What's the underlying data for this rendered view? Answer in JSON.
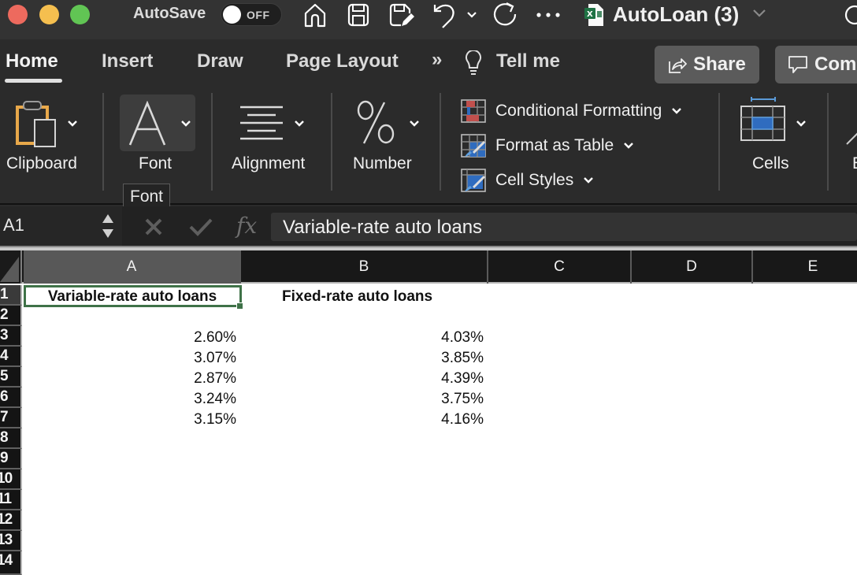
{
  "titlebar": {
    "autosave_label": "AutoSave",
    "autosave_state": "OFF",
    "doc_title": "AutoLoan (3)",
    "icons": [
      "home-icon",
      "save-icon",
      "save-as-icon",
      "undo-icon",
      "undo-dropdown-icon",
      "redo-icon",
      "more-icon",
      "excel-file-icon",
      "search-icon"
    ]
  },
  "tabs": [
    {
      "label": "Home",
      "active": true
    },
    {
      "label": "Insert"
    },
    {
      "label": "Draw"
    },
    {
      "label": "Page Layout"
    },
    {
      "label": "»"
    },
    {
      "label": "Tell me"
    }
  ],
  "actions": {
    "share_label": "Share",
    "comments_label": "Com"
  },
  "ribbon": {
    "groups": [
      {
        "label": "Clipboard",
        "icon": "clipboard-icon"
      },
      {
        "label": "Font",
        "icon": "font-icon"
      },
      {
        "label": "Alignment",
        "icon": "alignment-icon"
      },
      {
        "label": "Number",
        "icon": "percent-icon"
      },
      {
        "label": "Cells",
        "icon": "cells-icon"
      },
      {
        "label": "E",
        "icon": "editing-icon"
      }
    ],
    "styles": [
      {
        "label": "Conditional Formatting",
        "icon": "conditional-formatting-icon"
      },
      {
        "label": "Format as Table",
        "icon": "format-as-table-icon"
      },
      {
        "label": "Cell Styles",
        "icon": "cell-styles-icon"
      }
    ],
    "tooltip": "Font"
  },
  "formula_bar": {
    "name_box": "A1",
    "formula": "Variable-rate auto loans",
    "fx_label": "fx"
  },
  "sheet": {
    "columns": [
      "A",
      "B",
      "C",
      "D",
      "E"
    ],
    "selected_cell": "A1",
    "rows": [
      "1",
      "2",
      "3",
      "4",
      "5",
      "6",
      "7",
      "8",
      "9",
      "10",
      "11",
      "12",
      "13",
      "14"
    ],
    "cells": {
      "A1": "Variable-rate auto loans",
      "B1": "Fixed-rate auto loans",
      "A3": "2.60%",
      "B3": "4.03%",
      "A4": "3.07%",
      "B4": "3.85%",
      "A5": "2.87%",
      "B5": "4.39%",
      "A6": "3.24%",
      "B6": "3.75%",
      "A7": "3.15%",
      "B7": "4.16%"
    }
  },
  "colors": {
    "selection": "#3f7248",
    "ribbon_bg": "#2b2b2b",
    "accent_blue": "#2f6cbf",
    "accent_red": "#c0504d"
  }
}
